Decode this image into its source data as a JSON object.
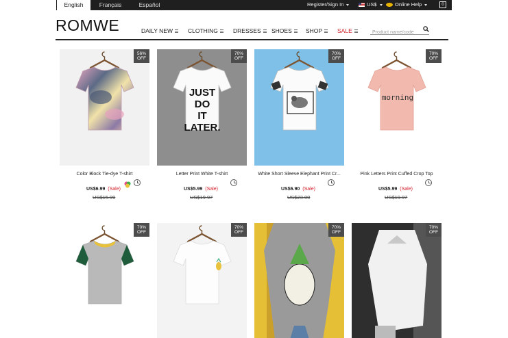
{
  "languages": [
    "English",
    "Français",
    "Español"
  ],
  "topbar": {
    "register": "Register/Sign In",
    "currency": "US$",
    "help": "Online Help",
    "cart_count": "0"
  },
  "brand": "ROMWE",
  "nav": [
    "DAILY NEW",
    "CLOTHING",
    "DRESSES",
    "SHOES",
    "SHOP",
    "SALE"
  ],
  "search": {
    "placeholder": "Product name/code"
  },
  "products": [
    {
      "name": "Color Block Tie-dye T-shirt",
      "discount": "56%",
      "off": "OFF",
      "price": "US$6.99",
      "sale": "(Sale)",
      "original": "US$15.99",
      "shirt": "tie-dye",
      "bg": "#f1f1f1"
    },
    {
      "name": "Letter Print White T-shirt",
      "discount": "70%",
      "off": "OFF",
      "price": "US$5.99",
      "sale": "(Sale)",
      "original": "US$19.97",
      "shirt": "letter",
      "bg": "#8a8a8a",
      "print": [
        "JUST",
        "DO",
        "IT",
        "LATER."
      ]
    },
    {
      "name": "White Short Sleeve Elephant Print Cr...",
      "discount": "70%",
      "off": "OFF",
      "price": "US$6.90",
      "sale": "(Sale)",
      "original": "US$23.00",
      "shirt": "elephant",
      "bg": "#7ec0e8"
    },
    {
      "name": "Pink Letters Print Cuffed Crop Top",
      "discount": "70%",
      "off": "OFF",
      "price": "US$5.99",
      "sale": "(Sale)",
      "original": "US$19.97",
      "shirt": "pink",
      "bg": "#ffffff",
      "print": [
        "morning"
      ]
    },
    {
      "discount": "70%",
      "off": "OFF",
      "shirt": "ringer",
      "bg": "#ffffff"
    },
    {
      "discount": "70%",
      "off": "OFF",
      "shirt": "pineapple-small",
      "bg": "#f3f3f3"
    },
    {
      "discount": "70%",
      "off": "OFF",
      "shirt": "pineapple-model",
      "bg": "#e8c23c"
    },
    {
      "discount": "70%",
      "off": "OFF",
      "shirt": "bw-model",
      "bg": "#3a3a3a"
    }
  ],
  "colors": {
    "accent": "#d0232d",
    "topbar": "#1f1f1f",
    "badge": "#4c4c4c"
  }
}
